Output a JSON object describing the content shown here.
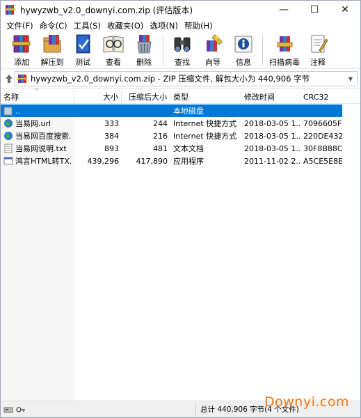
{
  "window": {
    "title": "hywyzwb_v2.0_downyi.com.zip (评估版本)",
    "controls": {
      "minimize": "—",
      "maximize": "☐",
      "close": "✕"
    }
  },
  "menu": [
    {
      "label": "文件(F)"
    },
    {
      "label": "命令(C)"
    },
    {
      "label": "工具(S)"
    },
    {
      "label": "收藏夹(O)"
    },
    {
      "label": "选项(N)"
    },
    {
      "label": "帮助(H)"
    }
  ],
  "toolbar": [
    {
      "label": "添加",
      "icon": "add-archive-icon"
    },
    {
      "label": "解压到",
      "icon": "extract-icon"
    },
    {
      "label": "测试",
      "icon": "test-icon"
    },
    {
      "label": "查看",
      "icon": "view-icon"
    },
    {
      "label": "删除",
      "icon": "delete-icon"
    },
    {
      "label": "查找",
      "icon": "find-icon"
    },
    {
      "label": "向导",
      "icon": "wizard-icon"
    },
    {
      "label": "信息",
      "icon": "info-icon"
    },
    {
      "label": "扫描病毒",
      "icon": "virus-scan-icon"
    },
    {
      "label": "注释",
      "icon": "comment-icon"
    }
  ],
  "address": {
    "text": "hywyzwb_v2.0_downyi.com.zip - ZIP 压缩文件, 解包大小为 440,906 字节"
  },
  "columns": {
    "name": "名称",
    "size": "大小",
    "packed": "压缩后大小",
    "type": "类型",
    "modified": "修改时间",
    "crc": "CRC32"
  },
  "files": [
    {
      "name": "..",
      "size": "",
      "packed": "",
      "type": "本地磁盘",
      "modified": "",
      "crc": "",
      "icon": "folder-up-icon",
      "selected": true
    },
    {
      "name": "当易网.url",
      "size": "333",
      "packed": "244",
      "type": "Internet 快捷方式",
      "modified": "2018-03-05 1...",
      "crc": "7096605F",
      "icon": "internet-shortcut-icon",
      "selected": false
    },
    {
      "name": "当易网百度搜索...",
      "size": "384",
      "packed": "216",
      "type": "Internet 快捷方式",
      "modified": "2018-03-05 1...",
      "crc": "220DE432",
      "icon": "internet-shortcut-icon",
      "selected": false
    },
    {
      "name": "当易网说明.txt",
      "size": "893",
      "packed": "481",
      "type": "文本文档",
      "modified": "2018-03-05 1...",
      "crc": "30F8B88C",
      "icon": "text-file-icon",
      "selected": false
    },
    {
      "name": "鸿言HTML转TX...",
      "size": "439,296",
      "packed": "417,890",
      "type": "应用程序",
      "modified": "2011-11-02 2...",
      "crc": "A5CE5E8E",
      "icon": "application-icon",
      "selected": false
    }
  ],
  "status": {
    "text": "总计 440,906 字节(4 个文件)"
  },
  "watermark": "Downyi.com",
  "colors": {
    "selection": "#0078d7",
    "watermark": "#f07a1a"
  }
}
